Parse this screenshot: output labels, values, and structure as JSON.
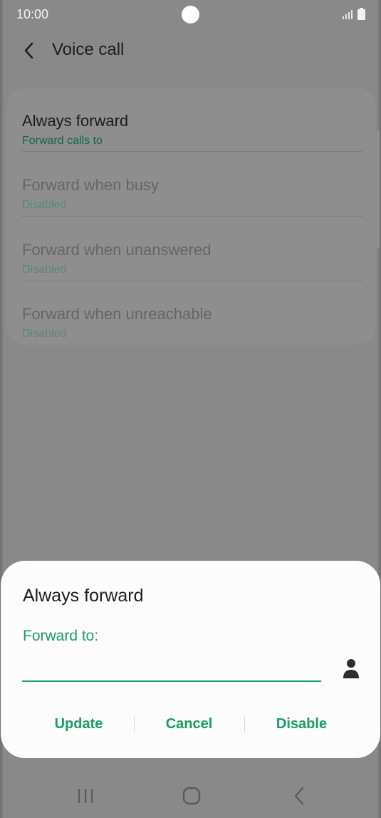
{
  "status_bar": {
    "time": "10:00"
  },
  "header": {
    "title": "Voice call",
    "back_icon": "chevron-left-icon"
  },
  "settings": {
    "items": [
      {
        "title": "Always forward",
        "subtitle": "Forward calls to",
        "state": "active"
      },
      {
        "title": "Forward when busy",
        "subtitle": "Disabled",
        "state": "disabled"
      },
      {
        "title": "Forward when unanswered",
        "subtitle": "Disabled",
        "state": "disabled"
      },
      {
        "title": "Forward when unreachable",
        "subtitle": "Disabled",
        "state": "disabled"
      }
    ]
  },
  "dialog": {
    "title": "Always forward",
    "field_label": "Forward to:",
    "field_value": "",
    "contact_icon": "person-icon",
    "buttons": {
      "update": "Update",
      "cancel": "Cancel",
      "disable": "Disable"
    }
  },
  "colors": {
    "accent": "#1a9c62",
    "overlay_background": "#898989",
    "dialog_background": "#fcfcfc"
  },
  "nav_bar": {
    "recents_icon": "recents-icon",
    "home_icon": "home-icon",
    "back_icon": "back-icon"
  }
}
